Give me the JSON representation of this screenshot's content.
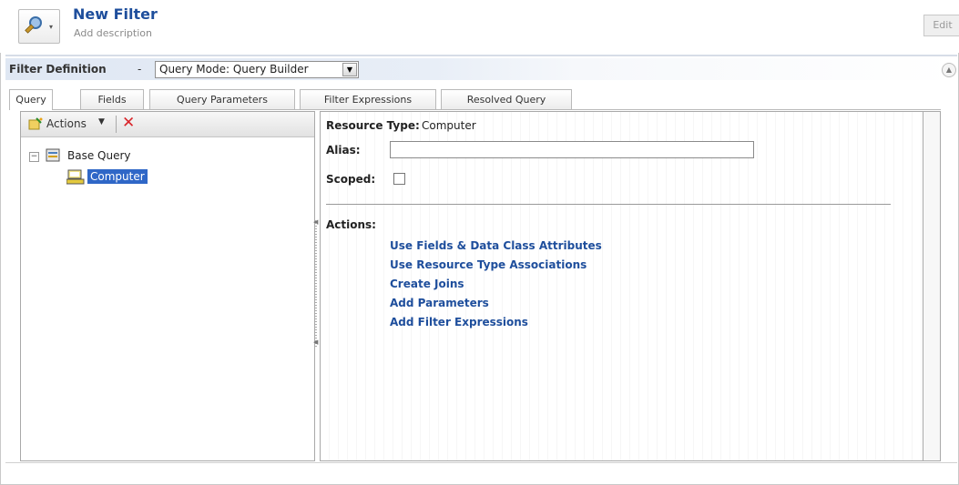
{
  "header": {
    "title": "New Filter",
    "subtitle": "Add description",
    "edit_label": "Edit"
  },
  "definition_bar": {
    "label": "Filter Definition",
    "separator": "-",
    "mode_value": "Query Mode: Query Builder"
  },
  "tabs": [
    {
      "label": "Query",
      "active": true
    },
    {
      "label": "Fields",
      "active": false
    },
    {
      "label": "Query Parameters",
      "active": false
    },
    {
      "label": "Filter Expressions",
      "active": false
    },
    {
      "label": "Resolved Query",
      "active": false
    }
  ],
  "left_pane": {
    "toolbar": {
      "actions_label": "Actions",
      "actions_icon": "wand-icon",
      "delete_icon": "red-x-icon"
    },
    "tree": {
      "root": {
        "label": "Base Query",
        "icon": "database-icon",
        "expanded": true
      },
      "child": {
        "label": "Computer",
        "icon": "computer-icon",
        "selected": true
      }
    }
  },
  "right_pane": {
    "resource_type_label": "Resource Type:",
    "resource_type_value": "Computer",
    "alias_label": "Alias:",
    "alias_value": "",
    "scoped_label": "Scoped:",
    "scoped_checked": false,
    "actions_label": "Actions:",
    "actions": [
      "Use Fields & Data Class Attributes",
      "Use Resource Type Associations",
      "Create Joins",
      "Add Parameters",
      "Add Filter Expressions"
    ]
  },
  "colors": {
    "title_blue": "#1e4e9c",
    "link_blue": "#1e4e9c",
    "selection_blue": "#2f67c7",
    "delete_red": "#d9252a"
  }
}
